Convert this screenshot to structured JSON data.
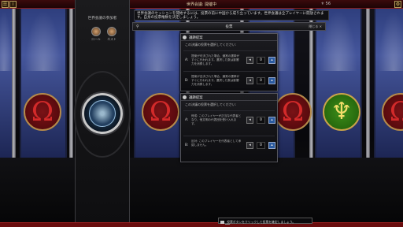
{
  "window": {
    "title": "世界会議: 開催中",
    "top_right": "⚜ 56"
  },
  "left_panel": {
    "header": "世界会議の参加者",
    "participants": [
      {
        "name": "ロール"
      },
      {
        "name": "ネスト"
      }
    ]
  },
  "message": "世界会議のセッションを開始するには、投票の前に中国から成り立っています。世界会議は全プレイヤーに開放されます。自身の投票権数を決定しましょう。",
  "dialog": {
    "title": "投票",
    "close_label": "閉じる ✕"
  },
  "cards": [
    {
      "header": "議題提案",
      "subtitle": "この決議の投票を選択してください:",
      "options": [
        {
          "label": "A:",
          "text": "提案が可決された場合、通常の選挙がすぐに行われます。選択した数は影響力を消費します。",
          "value": "0"
        },
        {
          "label": "B:",
          "text": "提案が否決された場合、通常の選挙がすぐに行われます。選択した数は影響力を消費します。",
          "value": "0"
        }
      ]
    },
    {
      "header": "議題提案",
      "subtitle": "この決議の投票を選択してください:",
      "options": [
        {
          "label": "A:",
          "text": "賛成: このプレイヤーが正当な代表者となり、他文明の代表団を受け入れます。",
          "value": "0"
        },
        {
          "label": "B:",
          "text": "反対: このプレイヤーを代表者として承認しません。",
          "value": "0"
        }
      ]
    }
  ],
  "footer": {
    "tooltip": "投票ボタンをクリックして投票を確定しましょう。"
  },
  "colors": {
    "banner": "#3a4a8c",
    "omega": "#7a1216",
    "palm": "#3d8d1a",
    "title_bar": "#3a0a0c"
  }
}
